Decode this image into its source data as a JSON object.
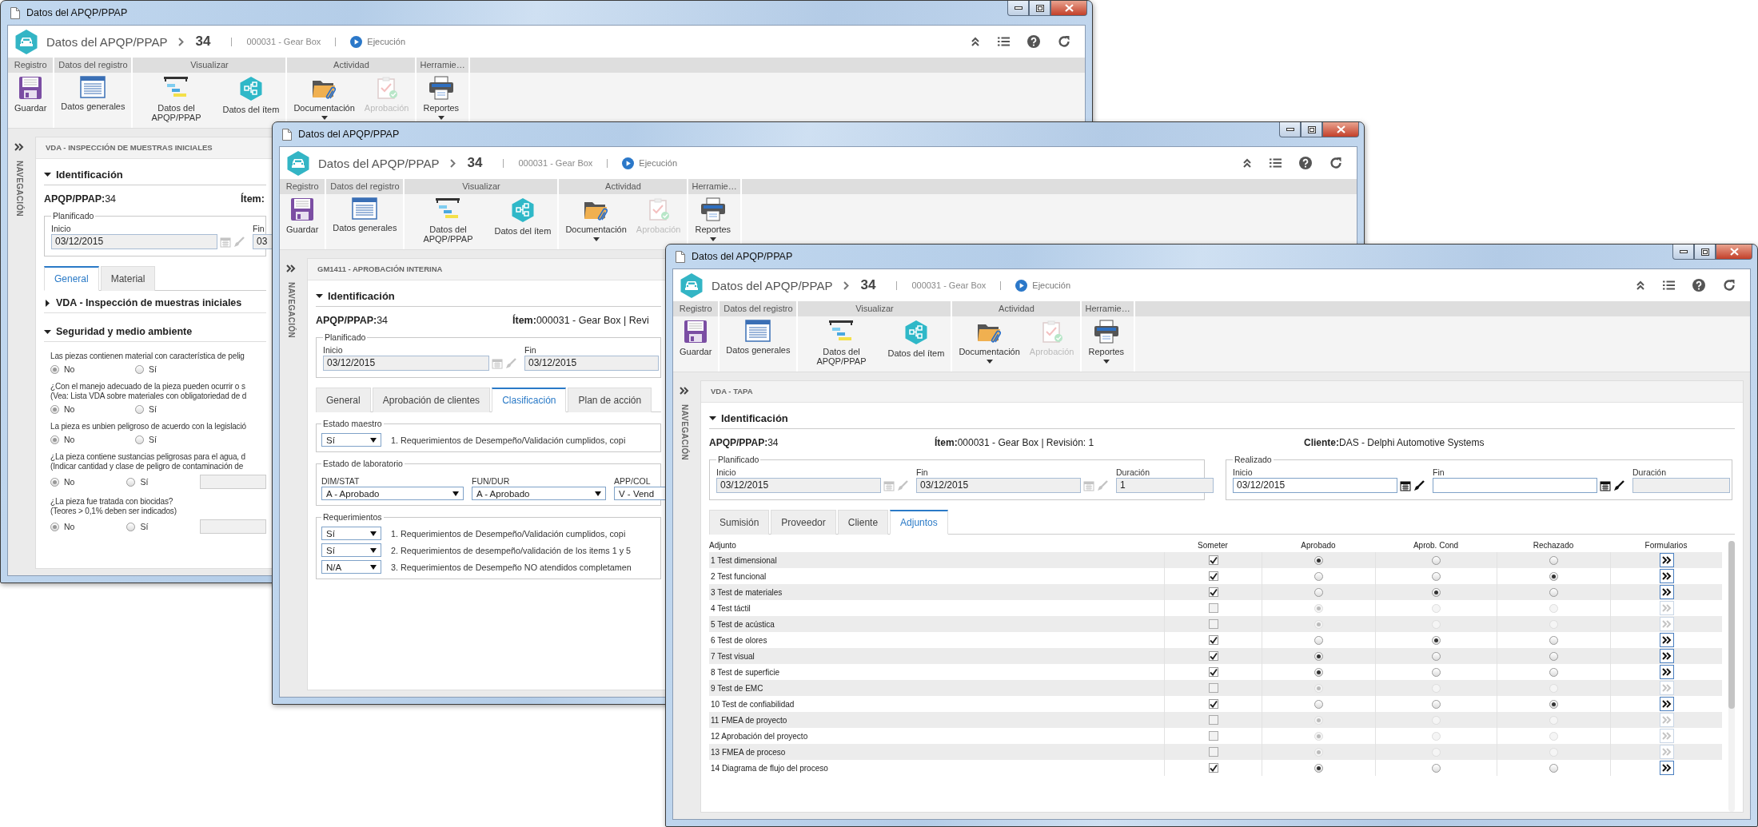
{
  "windows": [
    {
      "kind": "inspection",
      "title": "Datos del APQP/PPAP",
      "app_name": "Datos del APQP/PPAP",
      "record_number": "34",
      "item": "000031 - Gear Box",
      "status": "Ejecución",
      "ribbon": [
        {
          "label": "Registro",
          "buttons": [
            {
              "label": "Guardar",
              "disabled": false,
              "dropdown": false
            }
          ]
        },
        {
          "label": "Datos del registro",
          "buttons": [
            {
              "label": "Datos generales",
              "disabled": false,
              "dropdown": false
            }
          ]
        },
        {
          "label": "Visualizar",
          "buttons": [
            {
              "label": "Datos del APQP/PPAP",
              "disabled": false,
              "dropdown": false
            },
            {
              "label": "Datos del ítem",
              "disabled": false,
              "dropdown": false
            }
          ]
        },
        {
          "label": "Actividad",
          "buttons": [
            {
              "label": "Documentación",
              "disabled": false,
              "dropdown": true
            },
            {
              "label": "Aprobación",
              "disabled": true,
              "dropdown": false
            }
          ]
        },
        {
          "label": "Herramie…",
          "buttons": [
            {
              "label": "Reportes",
              "disabled": false,
              "dropdown": true
            }
          ]
        }
      ],
      "nav_label": "NAVEGACIÓN",
      "panel_title": "VDA - INSPECCIÓN DE MUESTRAS INICIALES",
      "section": {
        "label": "Identificación",
        "expanded": true
      },
      "info": [
        {
          "label": "APQP/PPAP:",
          "value": "34"
        },
        {
          "label": "Ítem:"
        }
      ],
      "date_groups": [
        {
          "legend": "Planificado",
          "fields": [
            {
              "label": "Inicio",
              "value": "03/12/2015",
              "kind": "date",
              "editable": false
            },
            {
              "label": "Fin",
              "value": "03",
              "kind": "text",
              "editable": false
            }
          ]
        }
      ],
      "tabs": [
        {
          "label": "General",
          "selected": true
        },
        {
          "label": "Material",
          "selected": false
        }
      ],
      "subsections": [
        {
          "label": "VDA - Inspección de muestras iniciales",
          "expanded": false
        },
        {
          "label": "Seguridad y medio ambiente",
          "expanded": true,
          "questions": [
            {
              "lines": [
                "Las piezas contienen material con característica de pelig"
              ],
              "has_field": false,
              "options": [
                {
                  "label": "No",
                  "selected": true
                },
                {
                  "label": "Sí",
                  "selected": false
                }
              ]
            },
            {
              "lines": [
                "¿Con el manejo adecuado de la pieza pueden ocurrir o s",
                "(Vea: Lista VDA sobre materiales con obligatoriedad de d"
              ],
              "has_field": false,
              "options": [
                {
                  "label": "No",
                  "selected": true
                },
                {
                  "label": "Sí",
                  "selected": false
                }
              ]
            },
            {
              "lines": [
                "La pieza es unbien peligroso de acuerdo con la legislació"
              ],
              "has_field": false,
              "options": [
                {
                  "label": "No",
                  "selected": true
                },
                {
                  "label": "Sí",
                  "selected": false
                }
              ]
            },
            {
              "lines": [
                "¿La pieza contiene sustancias peligrosas para el agua, d",
                "(Indicar cantidad y clase de peligro de contaminación de"
              ],
              "has_field": true,
              "options": [
                {
                  "label": "No",
                  "selected": true
                },
                {
                  "label": "Sí",
                  "selected": false
                }
              ]
            },
            {
              "lines": [
                "¿La pieza fue tratada con biocidas?",
                "(Teores > 0,1% deben ser indicados)"
              ],
              "has_field": true,
              "options": [
                {
                  "label": "No",
                  "selected": true
                },
                {
                  "label": "Sí",
                  "selected": false
                }
              ]
            }
          ]
        }
      ]
    },
    {
      "kind": "approval",
      "title": "Datos del APQP/PPAP",
      "app_name": "Datos del APQP/PPAP",
      "record_number": "34",
      "item": "000031 - Gear Box",
      "status": "Ejecución",
      "ribbon": [
        {
          "label": "Registro",
          "buttons": [
            {
              "label": "Guardar",
              "disabled": false,
              "dropdown": false
            }
          ]
        },
        {
          "label": "Datos del registro",
          "buttons": [
            {
              "label": "Datos generales",
              "disabled": false,
              "dropdown": false
            }
          ]
        },
        {
          "label": "Visualizar",
          "buttons": [
            {
              "label": "Datos del APQP/PPAP",
              "disabled": false,
              "dropdown": false
            },
            {
              "label": "Datos del ítem",
              "disabled": false,
              "dropdown": false
            }
          ]
        },
        {
          "label": "Actividad",
          "buttons": [
            {
              "label": "Documentación",
              "disabled": false,
              "dropdown": true
            },
            {
              "label": "Aprobación",
              "disabled": true,
              "dropdown": false
            }
          ]
        },
        {
          "label": "Herramie…",
          "buttons": [
            {
              "label": "Reportes",
              "disabled": false,
              "dropdown": true
            }
          ]
        }
      ],
      "nav_label": "NAVEGACIÓN",
      "panel_title": "GM1411 - APROBACIÓN INTERINA",
      "section": {
        "label": "Identificación",
        "expanded": true
      },
      "info": [
        {
          "label": "APQP/PPAP:",
          "value": "34"
        },
        {
          "label": "Ítem:",
          "value": "000031 - Gear Box | Revi"
        }
      ],
      "date_groups": [
        {
          "legend": "Planificado",
          "fields": [
            {
              "label": "Inicio",
              "value": "03/12/2015",
              "kind": "date",
              "editable": false
            },
            {
              "label": "Fin",
              "value": "03/12/2015",
              "kind": "text",
              "editable": false
            }
          ]
        }
      ],
      "tabs": [
        {
          "label": "General",
          "selected": false
        },
        {
          "label": "Aprobación de clientes",
          "selected": false
        },
        {
          "label": "Clasificación",
          "selected": true
        },
        {
          "label": "Plan de acción",
          "selected": false
        }
      ],
      "groups": [
        {
          "kind": "select_list",
          "legend": "Estado maestro",
          "rows": [
            {
              "value": "Sí",
              "text": "1. Requerimientos de Desempeño/Validación cumplidos, copi"
            }
          ]
        },
        {
          "kind": "select_grid",
          "legend": "Estado de laboratorio",
          "fields": [
            {
              "label": "DIM/STAT",
              "value": "A - Aprobado"
            },
            {
              "label": "FUN/DUR",
              "value": "A - Aprobado"
            },
            {
              "label": "APP/COL",
              "value": "V - Vend"
            }
          ]
        },
        {
          "kind": "select_list",
          "legend": "Requerimientos",
          "rows": [
            {
              "value": "Sí",
              "text": "1. Requerimientos de Desempeño/Validación cumplidos, copi"
            },
            {
              "value": "Sí",
              "text": "2. Requerimientos de desempeño/validación de los items 1 y 5"
            },
            {
              "value": "N/A",
              "text": "3. Requerimientos de Desempeño NO atendidos completamen"
            }
          ]
        }
      ]
    },
    {
      "kind": "attachments",
      "title": "Datos del APQP/PPAP",
      "app_name": "Datos del APQP/PPAP",
      "record_number": "34",
      "item": "000031 - Gear Box",
      "status": "Ejecución",
      "ribbon": [
        {
          "label": "Registro",
          "buttons": [
            {
              "label": "Guardar",
              "disabled": false,
              "dropdown": false
            }
          ]
        },
        {
          "label": "Datos del registro",
          "buttons": [
            {
              "label": "Datos generales",
              "disabled": false,
              "dropdown": false
            }
          ]
        },
        {
          "label": "Visualizar",
          "buttons": [
            {
              "label": "Datos del APQP/PPAP",
              "disabled": false,
              "dropdown": false
            },
            {
              "label": "Datos del ítem",
              "disabled": false,
              "dropdown": false
            }
          ]
        },
        {
          "label": "Actividad",
          "buttons": [
            {
              "label": "Documentación",
              "disabled": false,
              "dropdown": true
            },
            {
              "label": "Aprobación",
              "disabled": true,
              "dropdown": false
            }
          ]
        },
        {
          "label": "Herramie…",
          "buttons": [
            {
              "label": "Reportes",
              "disabled": false,
              "dropdown": true
            }
          ]
        }
      ],
      "nav_label": "NAVEGACIÓN",
      "panel_title": "VDA - TAPA",
      "section": {
        "label": "Identificación",
        "expanded": true
      },
      "info": [
        {
          "label": "APQP/PPAP:",
          "value": "34"
        },
        {
          "label": "Ítem:",
          "value": "000031 - Gear Box | Revisión: 1"
        },
        {
          "label": "Cliente:",
          "value": "DAS - Delphi Automotive Systems"
        }
      ],
      "date_groups": [
        {
          "legend": "Planificado",
          "fields": [
            {
              "label": "Inicio",
              "value": "03/12/2015",
              "kind": "date",
              "editable": false
            },
            {
              "label": "Fin",
              "value": "03/12/2015",
              "kind": "date",
              "editable": false
            },
            {
              "label": "Duración",
              "value": "1",
              "kind": "text",
              "editable": false
            }
          ]
        },
        {
          "legend": "Realizado",
          "fields": [
            {
              "label": "Inicio",
              "value": "03/12/2015",
              "kind": "date",
              "editable": true
            },
            {
              "label": "Fin",
              "kind": "date",
              "editable": true
            },
            {
              "label": "Duración",
              "kind": "text",
              "editable": false
            }
          ]
        }
      ],
      "tabs": [
        {
          "label": "Sumisión",
          "selected": false
        },
        {
          "label": "Proveedor",
          "selected": false
        },
        {
          "label": "Cliente",
          "selected": false
        },
        {
          "label": "Adjuntos",
          "selected": true
        }
      ],
      "table": {
        "columns": [
          "Adjunto",
          "Someter",
          "Aprobado",
          "Aprob. Cond",
          "Rechazado",
          "Formularios"
        ],
        "rows": [
          {
            "name": "1 Test dimensional",
            "submitted": true,
            "approved": true,
            "conditional": false,
            "rejected": false
          },
          {
            "name": "2 Test funcional",
            "submitted": true,
            "approved": false,
            "conditional": false,
            "rejected": true
          },
          {
            "name": "3 Test de materiales",
            "submitted": true,
            "approved": false,
            "conditional": true,
            "rejected": false
          },
          {
            "name": "4 Test táctil",
            "submitted": false,
            "approved": true,
            "conditional": false,
            "rejected": false
          },
          {
            "name": "5 Test de acústica",
            "submitted": false,
            "approved": true,
            "conditional": false,
            "rejected": false
          },
          {
            "name": "6 Test de olores",
            "submitted": true,
            "approved": false,
            "conditional": true,
            "rejected": false
          },
          {
            "name": "7 Test visual",
            "submitted": true,
            "approved": true,
            "conditional": false,
            "rejected": false
          },
          {
            "name": "8 Test de superficie",
            "submitted": true,
            "approved": true,
            "conditional": false,
            "rejected": false
          },
          {
            "name": "9 Test de EMC",
            "submitted": false,
            "approved": true,
            "conditional": false,
            "rejected": false
          },
          {
            "name": "10 Test de confiabilidad",
            "submitted": true,
            "approved": false,
            "conditional": false,
            "rejected": true
          },
          {
            "name": "11 FMEA de proyecto",
            "submitted": false,
            "approved": true,
            "conditional": false,
            "rejected": false
          },
          {
            "name": "12 Aprobación del proyecto",
            "submitted": false,
            "approved": true,
            "conditional": false,
            "rejected": false
          },
          {
            "name": "13 FMEA de proceso",
            "submitted": false,
            "approved": true,
            "conditional": false,
            "rejected": false
          },
          {
            "name": "14 Diagrama de flujo del proceso",
            "submitted": true,
            "approved": true,
            "conditional": false,
            "rejected": false
          }
        ]
      }
    }
  ]
}
